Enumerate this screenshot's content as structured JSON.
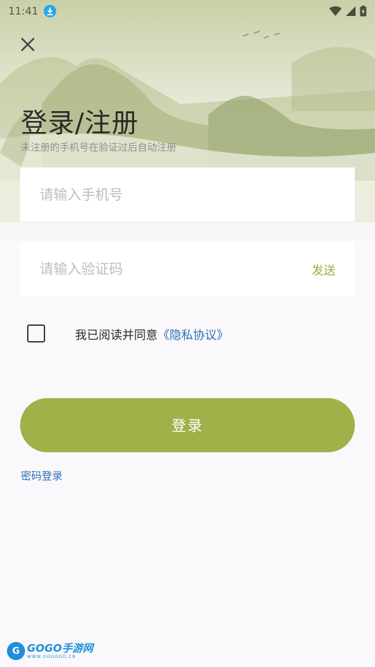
{
  "status_bar": {
    "time": "11:41"
  },
  "header": {
    "title": "登录/注册",
    "subtitle": "未注册的手机号在验证过后自动注册"
  },
  "form": {
    "phone_placeholder": "请输入手机号",
    "phone_value": "",
    "code_placeholder": "请输入验证码",
    "code_value": "",
    "send_label": "发送"
  },
  "agreement": {
    "checked": false,
    "text": "我已阅读并同意",
    "link": "《隐私协议》"
  },
  "login_button": "登录",
  "password_login": "密码登录",
  "watermark": {
    "brand": "GOGO手游网",
    "url": "WWW.GOGOGO.CN"
  },
  "colors": {
    "accent": "#a1b048",
    "link": "#2b6fb7",
    "send": "#98ad43"
  }
}
